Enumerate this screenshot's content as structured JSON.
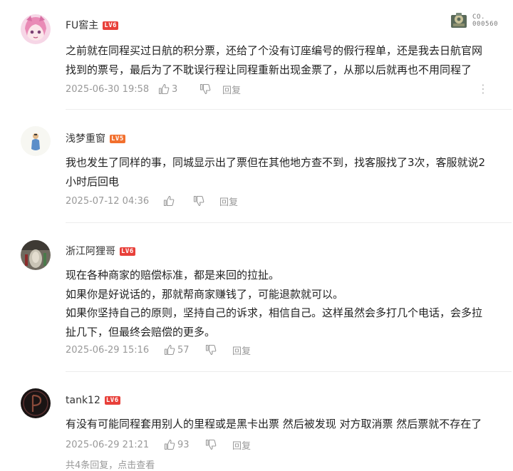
{
  "badge": {
    "line1": "CO.",
    "line2": "000560"
  },
  "comments": [
    {
      "username": "FU窖主",
      "level": "LV6",
      "lines": [
        "之前就在同程买过日航的积分票，还给了个没有订座编号的假行程单，还是我去日航官网",
        "找到的票号，最后为了不耽误行程让同程重新出现金票了，从那以后就再也不用同程了"
      ],
      "time": "2025-06-30 19:58",
      "likes": "3",
      "reply_label": "回复",
      "more_label": "⋮"
    },
    {
      "username": "浅梦重窗",
      "level": "LV5",
      "lines": [
        "我也发生了同样的事，同城显示出了票但在其他地方查不到，找客服找了3次，客服就说2",
        "小时后回电"
      ],
      "time": "2025-07-12 04:36",
      "likes": "",
      "reply_label": "回复"
    },
    {
      "username": "浙江阿狸哥",
      "level": "LV6",
      "lines": [
        "现在各种商家的赔偿标准，都是来回的拉扯。",
        "如果你是好说话的，那就帮商家赚钱了，可能退款就可以。",
        "如果你坚持自己的原则，坚持自己的诉求，相信自己。这样虽然会多打几个电话，会多拉",
        "扯几下，但最终会赔偿的更多。"
      ],
      "time": "2025-06-29 15:16",
      "likes": "57",
      "reply_label": "回复"
    },
    {
      "username": "tank12",
      "level": "LV6",
      "lines": [
        "有没有可能同程套用别人的里程或是黑卡出票 然后被发现 对方取消票 然后票就不存在了"
      ],
      "time": "2025-06-29 21:21",
      "likes": "93",
      "reply_label": "回复"
    }
  ],
  "replies_link": "共4条回复，点击查看",
  "colors": {
    "lv6": "#e8403a",
    "lv5": "#f2702e",
    "meta_text": "#999999",
    "body_text": "#222222"
  }
}
